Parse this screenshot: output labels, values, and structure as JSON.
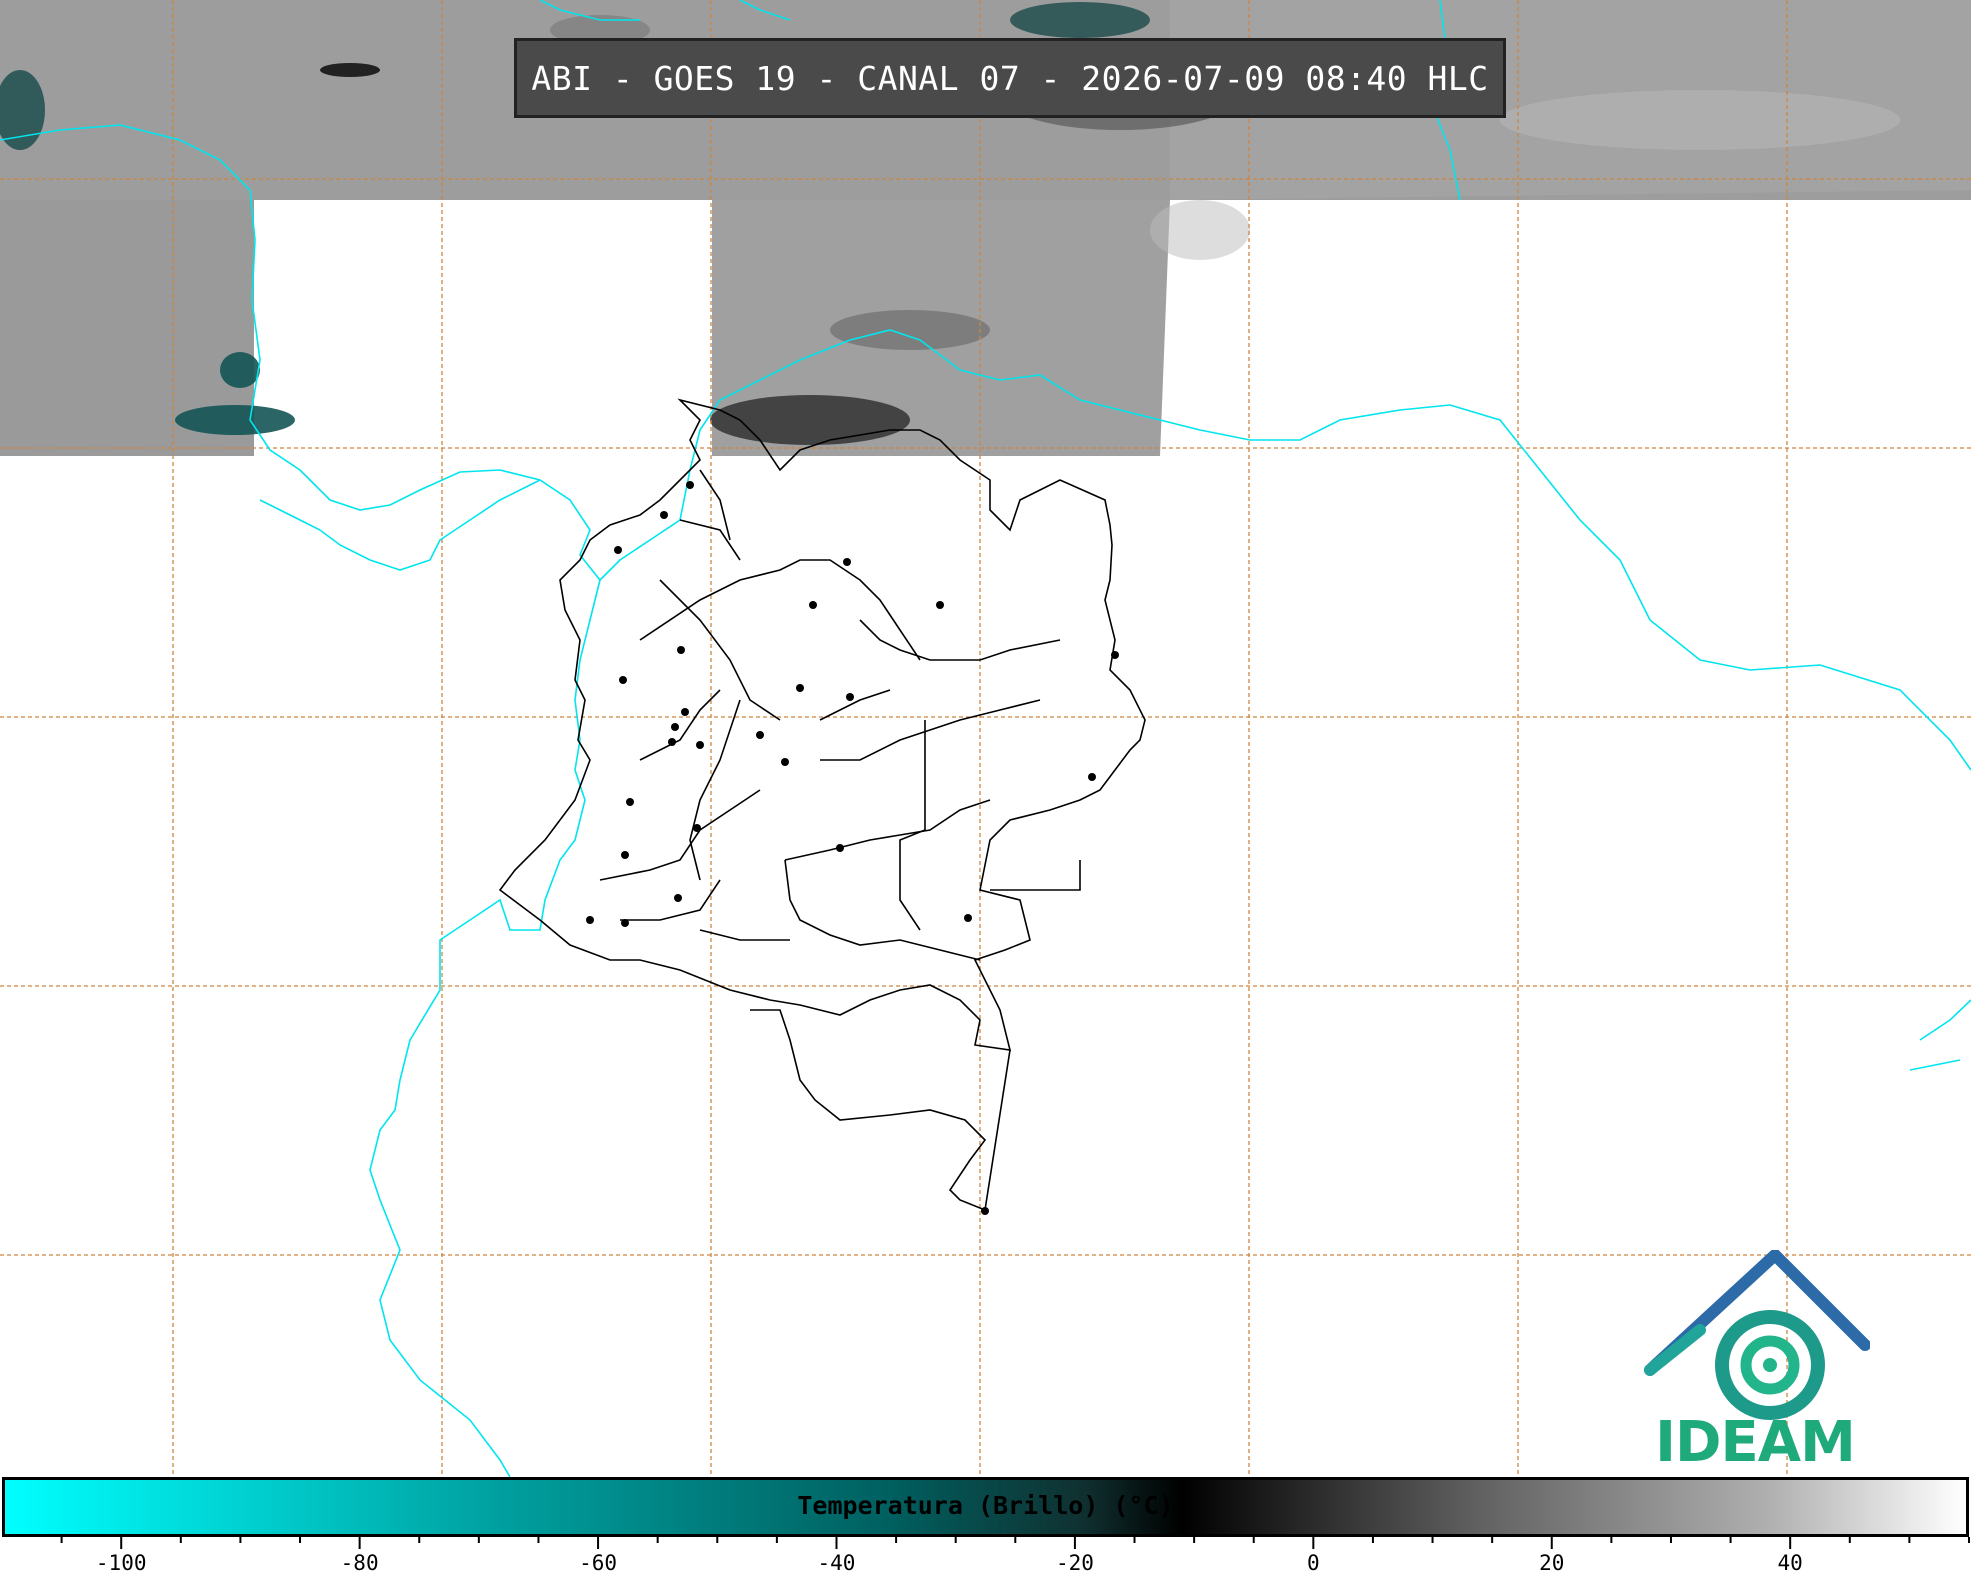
{
  "title": "ABI - GOES 19 - CANAL 07 - 2026-07-09 08:40 HLC",
  "logo": {
    "text": "IDEAM",
    "icon": "ideam-logo-icon",
    "color": "#1faa7c"
  },
  "colorbar": {
    "label": "Temperatura (Brillo) (°C)",
    "min": -110,
    "max": 55,
    "tick_labels": [
      "-100",
      "-80",
      "-60",
      "-40",
      "-20",
      "0",
      "20",
      "40"
    ],
    "colors": [
      "#00ffff",
      "#006060",
      "#000000",
      "#ffffff"
    ]
  },
  "map": {
    "coastline_color": "#00e5ee",
    "border_color": "#000000",
    "grid_color": "#cd853f",
    "clouds_color": "#9a9a9a"
  }
}
